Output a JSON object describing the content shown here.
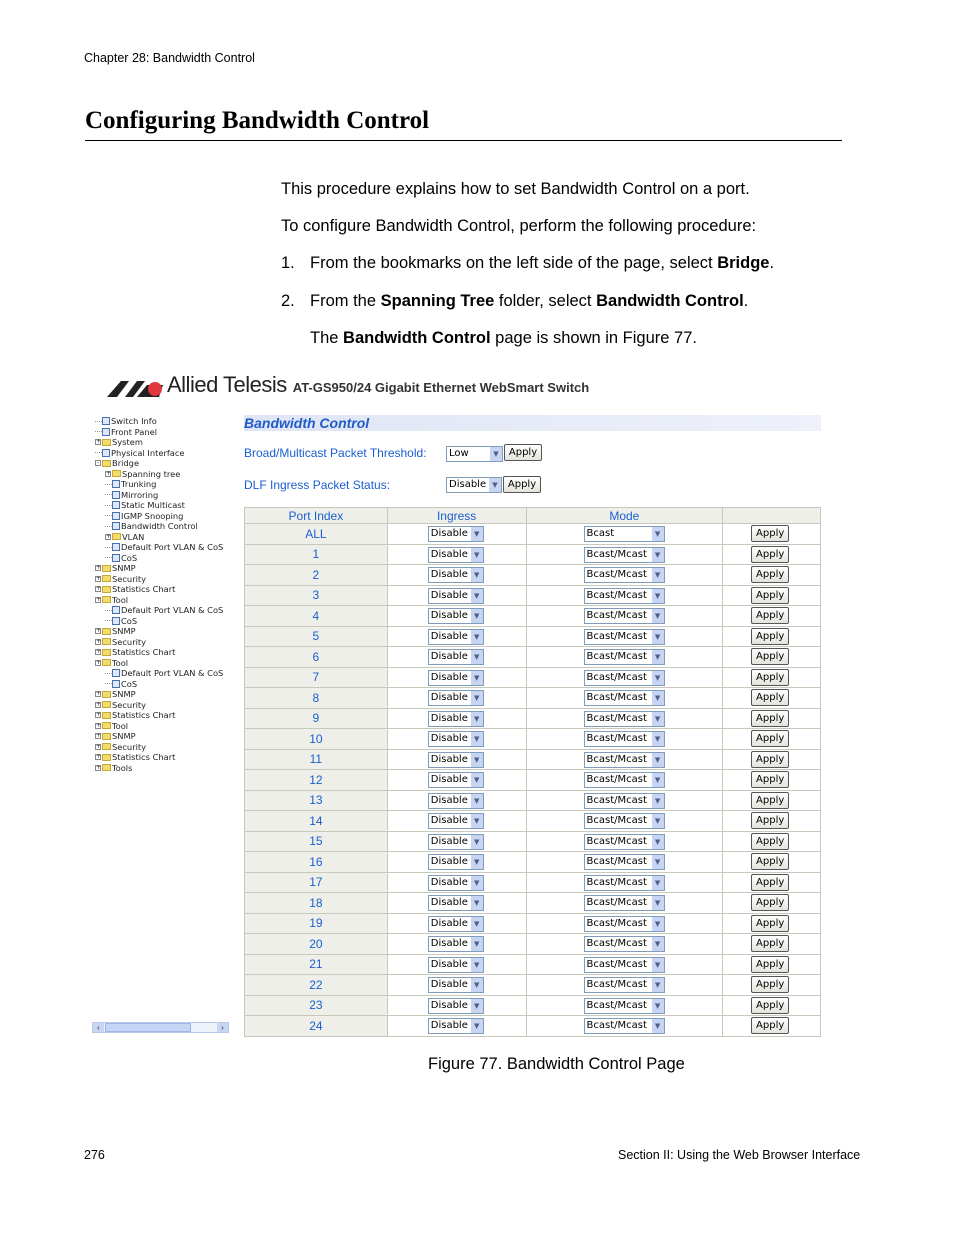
{
  "header": {
    "chapter": "Chapter 28: Bandwidth Control"
  },
  "title": "Configuring Bandwidth Control",
  "body": {
    "intro": "This procedure explains how to set Bandwidth Control on a port.",
    "lead": "To configure Bandwidth Control, perform the following procedure:",
    "step1_num": "1.",
    "step1_pre": "From the bookmarks on the left side of the page, select ",
    "step1_bold": "Bridge",
    "step1_post": ".",
    "step2_num": "2.",
    "step2_pre": "From the ",
    "step2_bold1": "Spanning Tree",
    "step2_mid": " folder, select ",
    "step2_bold2": "Bandwidth Control",
    "step2_post": ".",
    "note_pre": "The ",
    "note_bold": "Bandwidth Control",
    "note_post": " page is shown in Figure 77."
  },
  "screenshot": {
    "brand": "Allied Telesis",
    "model": "AT-GS950/24 Gigabit Ethernet WebSmart Switch",
    "page_title": "Bandwidth Control",
    "threshold_label": "Broad/Multicast Packet Threshold:",
    "threshold_value": "Low",
    "dlf_label": "DLF Ingress Packet Status:",
    "dlf_value": "Disable",
    "apply": "Apply",
    "columns": [
      "Port Index",
      "Ingress",
      "Mode",
      ""
    ],
    "rows": [
      {
        "port": "ALL",
        "ingress": "Disable",
        "mode": "Bcast"
      },
      {
        "port": "1",
        "ingress": "Disable",
        "mode": "Bcast/Mcast"
      },
      {
        "port": "2",
        "ingress": "Disable",
        "mode": "Bcast/Mcast"
      },
      {
        "port": "3",
        "ingress": "Disable",
        "mode": "Bcast/Mcast"
      },
      {
        "port": "4",
        "ingress": "Disable",
        "mode": "Bcast/Mcast"
      },
      {
        "port": "5",
        "ingress": "Disable",
        "mode": "Bcast/Mcast"
      },
      {
        "port": "6",
        "ingress": "Disable",
        "mode": "Bcast/Mcast"
      },
      {
        "port": "7",
        "ingress": "Disable",
        "mode": "Bcast/Mcast"
      },
      {
        "port": "8",
        "ingress": "Disable",
        "mode": "Bcast/Mcast"
      },
      {
        "port": "9",
        "ingress": "Disable",
        "mode": "Bcast/Mcast"
      },
      {
        "port": "10",
        "ingress": "Disable",
        "mode": "Bcast/Mcast"
      },
      {
        "port": "11",
        "ingress": "Disable",
        "mode": "Bcast/Mcast"
      },
      {
        "port": "12",
        "ingress": "Disable",
        "mode": "Bcast/Mcast"
      },
      {
        "port": "13",
        "ingress": "Disable",
        "mode": "Bcast/Mcast"
      },
      {
        "port": "14",
        "ingress": "Disable",
        "mode": "Bcast/Mcast"
      },
      {
        "port": "15",
        "ingress": "Disable",
        "mode": "Bcast/Mcast"
      },
      {
        "port": "16",
        "ingress": "Disable",
        "mode": "Bcast/Mcast"
      },
      {
        "port": "17",
        "ingress": "Disable",
        "mode": "Bcast/Mcast"
      },
      {
        "port": "18",
        "ingress": "Disable",
        "mode": "Bcast/Mcast"
      },
      {
        "port": "19",
        "ingress": "Disable",
        "mode": "Bcast/Mcast"
      },
      {
        "port": "20",
        "ingress": "Disable",
        "mode": "Bcast/Mcast"
      },
      {
        "port": "21",
        "ingress": "Disable",
        "mode": "Bcast/Mcast"
      },
      {
        "port": "22",
        "ingress": "Disable",
        "mode": "Bcast/Mcast"
      },
      {
        "port": "23",
        "ingress": "Disable",
        "mode": "Bcast/Mcast"
      },
      {
        "port": "24",
        "ingress": "Disable",
        "mode": "Bcast/Mcast"
      }
    ],
    "tree": [
      {
        "label": "Switch Info",
        "level": 0,
        "type": "leaf"
      },
      {
        "label": "Front Panel",
        "level": 0,
        "type": "leaf"
      },
      {
        "label": "System",
        "level": 0,
        "type": "folder",
        "state": "+"
      },
      {
        "label": "Physical Interface",
        "level": 0,
        "type": "leaf"
      },
      {
        "label": "Bridge",
        "level": 0,
        "type": "folder",
        "state": "-"
      },
      {
        "label": "Spanning tree",
        "level": 1,
        "type": "folder",
        "state": "+"
      },
      {
        "label": "Trunking",
        "level": 1,
        "type": "leaf"
      },
      {
        "label": "Mirroring",
        "level": 1,
        "type": "leaf"
      },
      {
        "label": "Static Multicast",
        "level": 1,
        "type": "leaf"
      },
      {
        "label": "IGMP Snooping",
        "level": 1,
        "type": "leaf"
      },
      {
        "label": "Bandwidth Control",
        "level": 1,
        "type": "leaf"
      },
      {
        "label": "VLAN",
        "level": 1,
        "type": "folder",
        "state": "+"
      },
      {
        "label": "Default Port VLAN & CoS",
        "level": 1,
        "type": "leaf"
      },
      {
        "label": "CoS",
        "level": 1,
        "type": "leaf"
      },
      {
        "label": "SNMP",
        "level": 0,
        "type": "folder",
        "state": "+"
      },
      {
        "label": "Security",
        "level": 0,
        "type": "folder",
        "state": "+"
      },
      {
        "label": "Statistics Chart",
        "level": 0,
        "type": "folder",
        "state": "+"
      },
      {
        "label": "Tool",
        "level": 0,
        "type": "folder",
        "state": "+"
      },
      {
        "label": "Default Port VLAN & CoS",
        "level": 1,
        "type": "leaf"
      },
      {
        "label": "CoS",
        "level": 1,
        "type": "leaf"
      },
      {
        "label": "SNMP",
        "level": 0,
        "type": "folder",
        "state": "+"
      },
      {
        "label": "Security",
        "level": 0,
        "type": "folder",
        "state": "+"
      },
      {
        "label": "Statistics Chart",
        "level": 0,
        "type": "folder",
        "state": "+"
      },
      {
        "label": "Tool",
        "level": 0,
        "type": "folder",
        "state": "+"
      },
      {
        "label": "Default Port VLAN & CoS",
        "level": 1,
        "type": "leaf"
      },
      {
        "label": "CoS",
        "level": 1,
        "type": "leaf"
      },
      {
        "label": "SNMP",
        "level": 0,
        "type": "folder",
        "state": "+"
      },
      {
        "label": "Security",
        "level": 0,
        "type": "folder",
        "state": "+"
      },
      {
        "label": "Statistics Chart",
        "level": 0,
        "type": "folder",
        "state": "+"
      },
      {
        "label": "Tool",
        "level": 0,
        "type": "folder",
        "state": "+"
      },
      {
        "label": "SNMP",
        "level": 0,
        "type": "folder",
        "state": "+"
      },
      {
        "label": "Security",
        "level": 0,
        "type": "folder",
        "state": "+"
      },
      {
        "label": "Statistics Chart",
        "level": 0,
        "type": "folder",
        "state": "+"
      },
      {
        "label": "Tools",
        "level": 0,
        "type": "folder",
        "state": "+"
      }
    ]
  },
  "caption": "Figure 77. Bandwidth Control Page",
  "footer": {
    "page_number": "276",
    "section": "Section II: Using the Web Browser Interface"
  },
  "colors": {
    "link_blue": "#1a5fd0",
    "header_bg": "#efefea"
  }
}
